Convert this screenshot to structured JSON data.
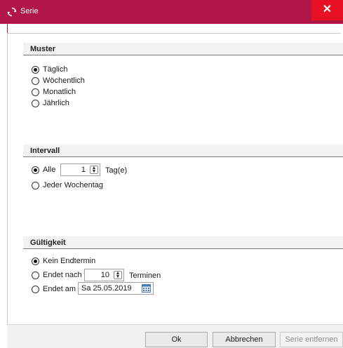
{
  "window": {
    "title": "Serie",
    "close_glyph": "✕"
  },
  "muster": {
    "title": "Muster",
    "options": [
      {
        "label": "Täglich",
        "checked": true
      },
      {
        "label": "Wöchentlich",
        "checked": false
      },
      {
        "label": "Monatlich",
        "checked": false
      },
      {
        "label": "Jährlich",
        "checked": false
      }
    ]
  },
  "intervall": {
    "title": "Intervall",
    "alle_label": "Alle",
    "alle_value": "1",
    "unit_label": "Tag(e)",
    "jeder_label": "Jeder Wochentag",
    "alle_checked": true
  },
  "gueltigkeit": {
    "title": "Gültigkeit",
    "kein_label": "Kein Endtermin",
    "nach_label": "Endet nach",
    "nach_value": "10",
    "termine_label": "Terminen",
    "am_label": "Endet am",
    "am_value": "Sa 25.05.2019",
    "selected": "kein"
  },
  "buttons": {
    "ok": "Ok",
    "cancel": "Abbrechen",
    "remove": "Serie entfernen"
  },
  "colors": {
    "titlebar": "#b01746",
    "close": "#e81123"
  },
  "icons": {
    "app": "refresh-icon",
    "calendar": "calendar-icon",
    "spinner": "spinner-icon"
  }
}
